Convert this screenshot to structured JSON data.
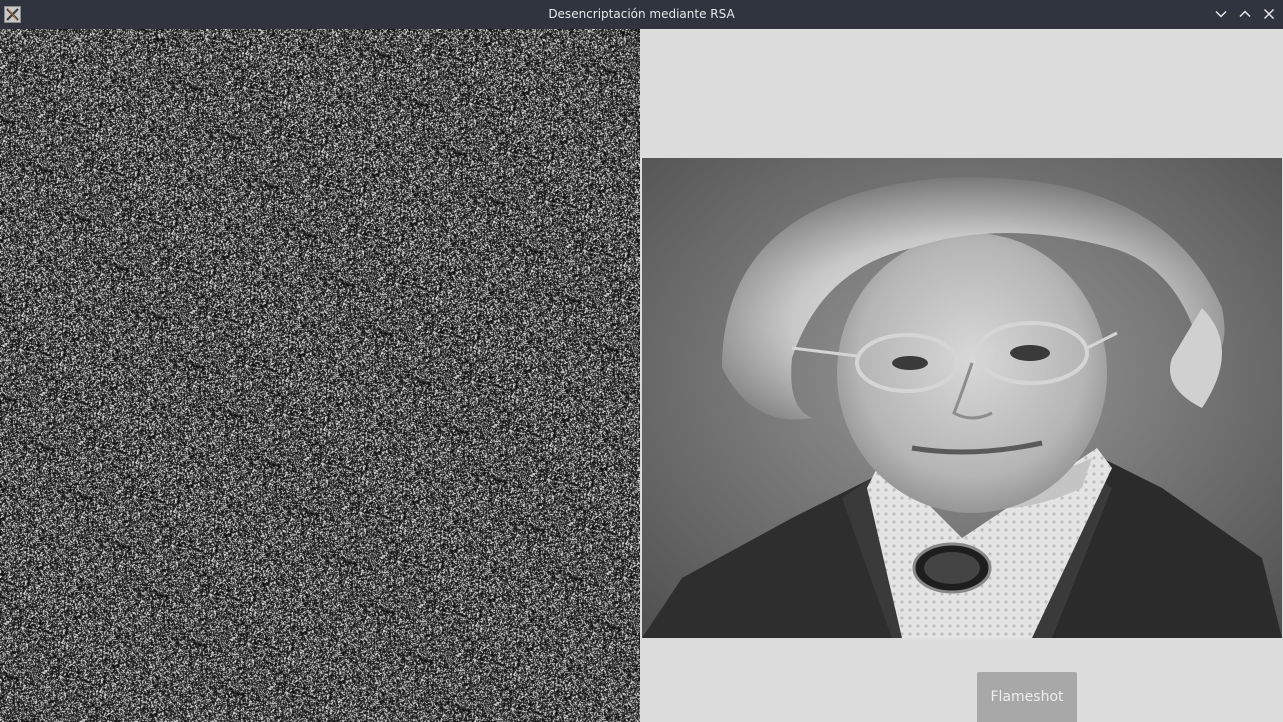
{
  "window": {
    "title": "Desencriptación mediante RSA",
    "app_icon": "x-icon",
    "controls": {
      "minimize_icon": "chevron-down-icon",
      "maximize_icon": "chevron-up-icon",
      "close_icon": "close-icon"
    },
    "colors": {
      "titlebar": "#2f343f",
      "client_bg": "#dcdcdc"
    }
  },
  "panes": {
    "encrypted": {
      "icon": "noise-image"
    },
    "decrypted": {
      "icon": "portrait-photo"
    }
  },
  "overlay": {
    "label": "Flameshot"
  }
}
